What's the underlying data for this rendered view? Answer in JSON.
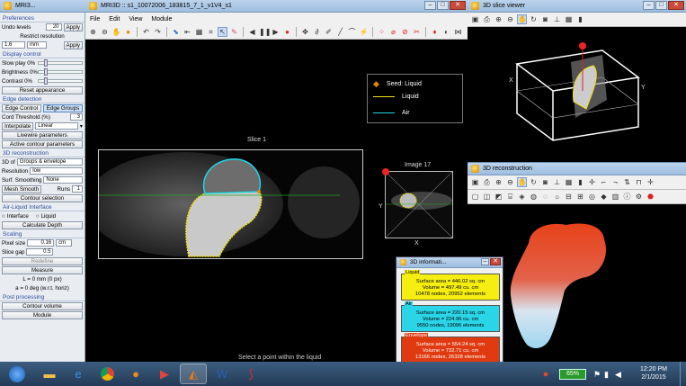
{
  "left_panel": {
    "title": "MRI3...",
    "preferences": {
      "header": "Preferences",
      "undo_label": "Undo levels",
      "undo_value": "20",
      "apply1": "Apply",
      "restrict_label": "Restrict resolution",
      "res_value": "1.6",
      "res_unit": "mm",
      "apply2": "Apply"
    },
    "display": {
      "header": "Display control",
      "slow_play": "Slow play 0%",
      "brightness": "Brightness 0%",
      "contrast": "Contrast 0%",
      "reset": "Reset appearance"
    },
    "edge": {
      "header": "Edge detection",
      "edge_control": "Edge Control",
      "edge_groups": "Edge Groups",
      "cord_label": "Cord Threshold (%)",
      "cord_value": "3",
      "interpolate": "Interpolate",
      "interp_mode": "Linear",
      "livewire": "Livewire parameters",
      "active_contour": "Active contour parameters"
    },
    "recon": {
      "header": "3D reconstruction",
      "of_label": "3D of",
      "of_value": "Groups & envelope",
      "res_label": "Resolution",
      "res_value": "low",
      "surf_label": "Surf. Smoothing",
      "surf_value": "None",
      "mesh": "Mesh Smooth",
      "runs_label": "Runs",
      "runs_value": "1",
      "contour_sel": "Contour selection"
    },
    "airliquid": {
      "header": "Air-Liquid Interface",
      "interface": "Interface",
      "liquid": "Liquid",
      "calc": "Calculate Depth"
    },
    "scaling": {
      "header": "Scaling",
      "pixel_label": "Pixel size",
      "pixel_value": "0.16",
      "unit": "cm",
      "gap_label": "Slice gap",
      "gap_value": "0.5",
      "redefine": "Redefine",
      "measure": "Measure",
      "l_text": "L = 0 mm (0 px)",
      "a_text": "a = 0 deg (w.r.t. horiz)"
    },
    "post": {
      "header": "Post processing",
      "contour_vol": "Contour volume",
      "module": "Module"
    }
  },
  "main": {
    "title": "MRI3D :: s1_10072006_183815_7_1_v1V4_s1",
    "menu": [
      "File",
      "Edit",
      "View",
      "Module"
    ],
    "slice_label": "Slice 1",
    "image_label": "Image 17",
    "axis_x": "X",
    "axis_y": "Y",
    "legend": {
      "seed": "Seed: Liquid",
      "liquid": "Liquid",
      "air": "Air"
    },
    "status": "Select a point within the liquid"
  },
  "slice_viewer": {
    "title": "3D slice viewer",
    "axis_x": "X",
    "axis_y": "Y"
  },
  "reconstruction": {
    "title": "3D reconstruction"
  },
  "info": {
    "title": "3D informati...",
    "liquid": {
      "header": "Liquid",
      "area": "Surface area = 446.02 sq. cm",
      "volume": "Volume = 497.49 cu. cm",
      "nodes": "10478 nodes, 20952 elements"
    },
    "air": {
      "header": "Air",
      "area": "Surface area = 220.15 sq. cm",
      "volume": "Volume = 224.96 cu. cm",
      "nodes": "9550 nodes, 19096 elements"
    },
    "envelope": {
      "header": "Envelope",
      "area": "Surface area = 554.24 sq. cm",
      "volume": "Volume = 732.71 cu. cm",
      "nodes": "13166 nodes, 26328 elements"
    }
  },
  "taskbar": {
    "battery": "65%",
    "time": "12:20 PM",
    "date": "2/1/2015"
  },
  "colors": {
    "liquid": "#f2e40a",
    "air": "#20d6e6",
    "envelope": "#e03a10",
    "accent": "#2a4d9c"
  }
}
